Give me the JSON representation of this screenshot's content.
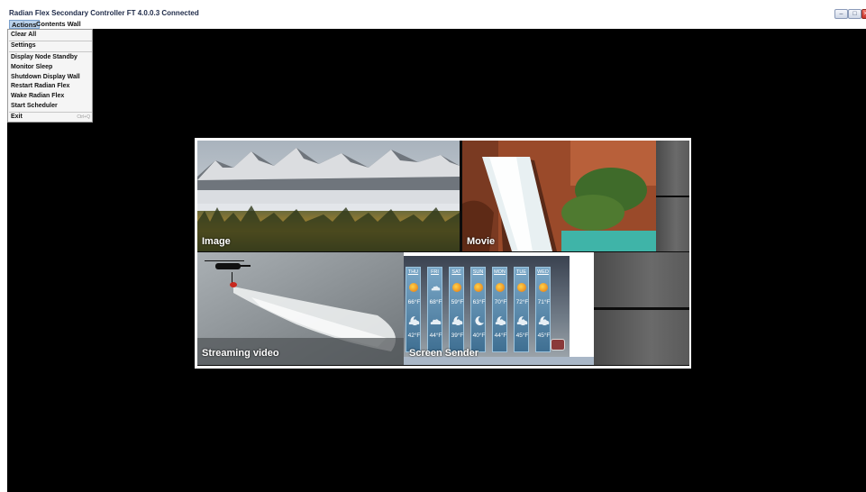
{
  "window": {
    "title": "Radian Flex Secondary Controller FT 4.0.0.3 Connected",
    "minimize": "–",
    "maximize": "□",
    "close": "×"
  },
  "menubar": {
    "actions": "Actions",
    "contents_wall": "Contents Wall"
  },
  "actions_menu": {
    "clear_all": "Clear All",
    "settings": "Settings",
    "display_node_standby": "Display Node Standby",
    "monitor_sleep": "Monitor Sleep",
    "shutdown_display_wall": "Shutdown Display Wall",
    "restart_radian_flex": "Restart Radian Flex",
    "wake_radian_flex": "Wake Radian Flex",
    "start_scheduler": "Start Scheduler",
    "exit": "Exit",
    "exit_shortcut": "Ctrl+Q"
  },
  "wall": {
    "tiles": {
      "image": "Image",
      "movie": "Movie",
      "streaming": "Streaming video",
      "screen_sender": "Screen Sender"
    },
    "weather": [
      {
        "day": "THU",
        "hi": "66°F",
        "lo": "42°F",
        "icon": "sun",
        "night": "cloud-moon"
      },
      {
        "day": "FRI",
        "hi": "68°F",
        "lo": "44°F",
        "icon": "cloud",
        "night": "cloud"
      },
      {
        "day": "SAT",
        "hi": "59°F",
        "lo": "39°F",
        "icon": "sun",
        "night": "cloud-moon"
      },
      {
        "day": "SUN",
        "hi": "63°F",
        "lo": "40°F",
        "icon": "sun",
        "night": "moon"
      },
      {
        "day": "MON",
        "hi": "70°F",
        "lo": "44°F",
        "icon": "sun",
        "night": "cloud-moon"
      },
      {
        "day": "TUE",
        "hi": "72°F",
        "lo": "45°F",
        "icon": "sun",
        "night": "cloud-moon"
      },
      {
        "day": "WED",
        "hi": "71°F",
        "lo": "45°F",
        "icon": "sun",
        "night": "cloud-moon"
      }
    ]
  }
}
